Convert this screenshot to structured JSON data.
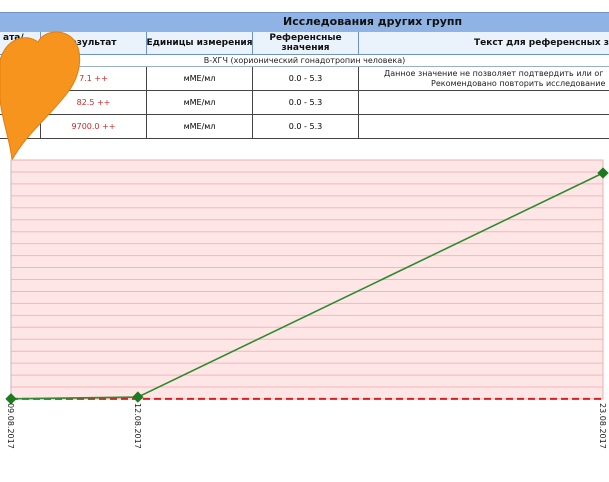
{
  "table": {
    "title": "Исследования других групп",
    "headers": {
      "date": "ата/\nка",
      "result": "езультат",
      "units": "Единицы измерения",
      "reference": "Референсные\nзначения",
      "ref_text": "Текст для референсных зна"
    },
    "group_label": "B-ХГЧ (хорионический гонадотропин человека)",
    "rows": [
      {
        "result": "7.1 ++",
        "units": "мМЕ/мл",
        "reference": "0.0 - 5.3",
        "note_line1": "Данное значение не позволяет подтвердить или ог",
        "note_line2": "Рекомендовано повторить исследование"
      },
      {
        "result": "82.5 ++",
        "units": "мМЕ/мл",
        "reference": "0.0 - 5.3"
      },
      {
        "result": "9700.0 ++",
        "units": "мМЕ/мл",
        "reference": "0.0 - 5.3"
      }
    ]
  },
  "overlay": {
    "icon": "heart-icon",
    "color": "#f7941d"
  },
  "chart_data": {
    "type": "line",
    "x": [
      "09.08.2017",
      "12.08.2017",
      "23.08.2017"
    ],
    "x_days": [
      0,
      3,
      14
    ],
    "series": [
      {
        "values": [
          7.1,
          82.5,
          9700.0
        ],
        "color": "#2e8b2e"
      }
    ],
    "reference_upper": 5.3,
    "ylim": [
      0,
      9700
    ],
    "grid": true,
    "colors": {
      "background": "#ffe6e6",
      "grid": "#f0b8b8",
      "reference_line": "#d42020"
    }
  }
}
